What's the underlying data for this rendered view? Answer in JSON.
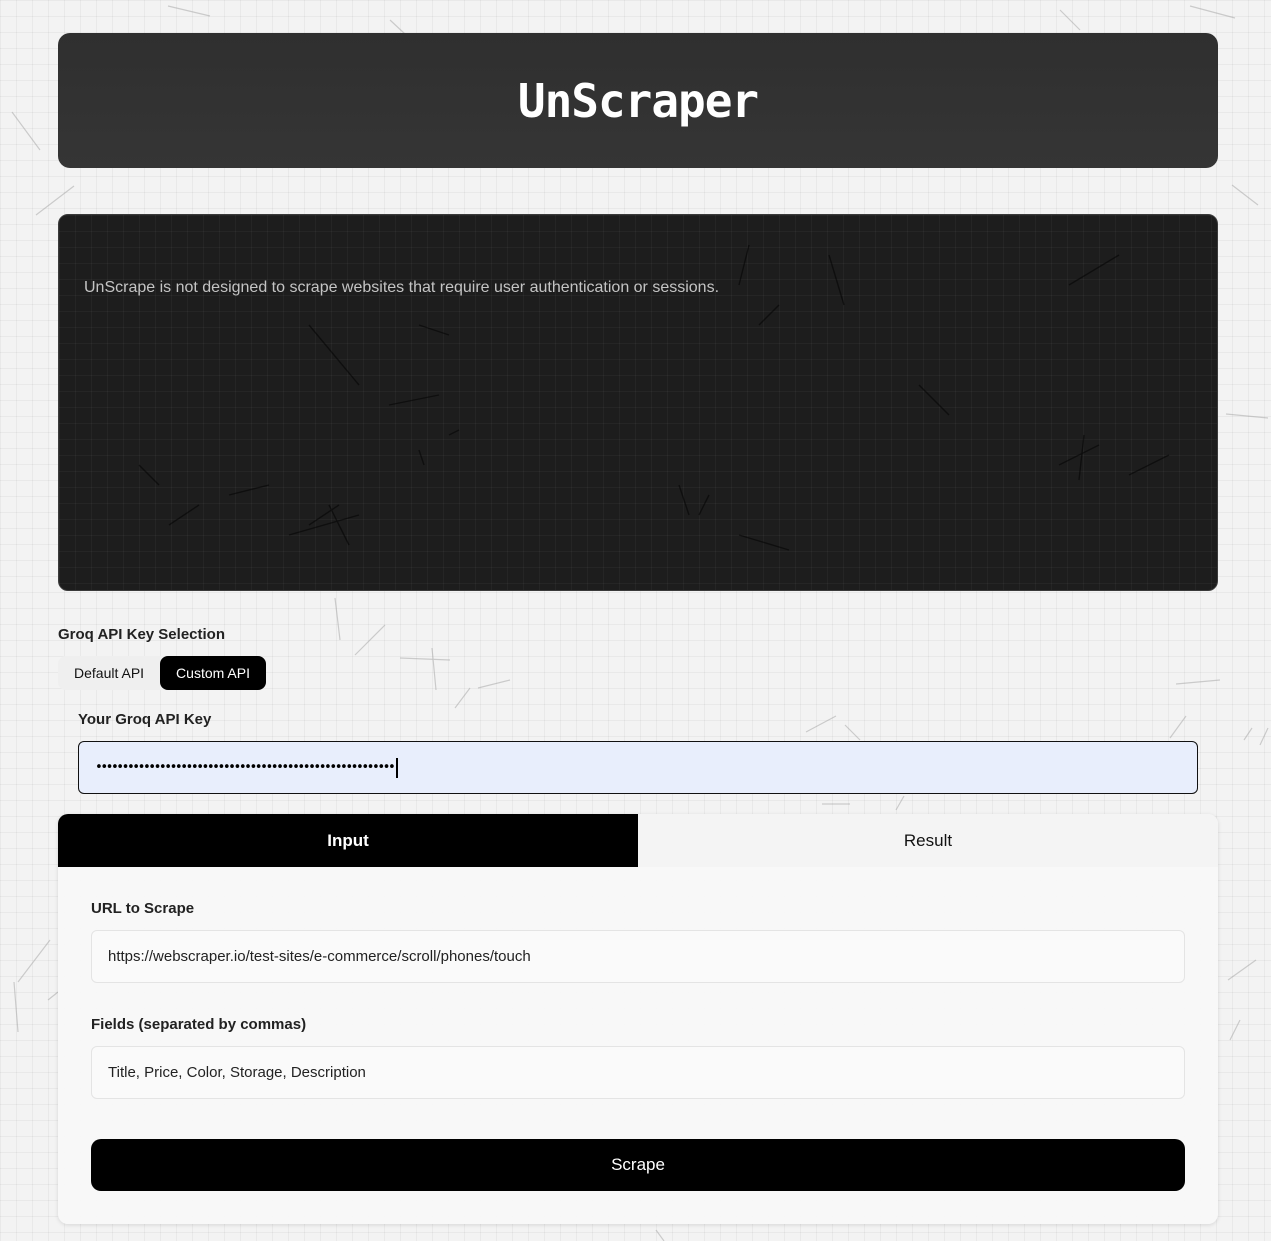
{
  "app": {
    "title": "UnScraper"
  },
  "notice": {
    "text": "UnScrape is not designed to scrape websites that require user authentication or sessions."
  },
  "api_selection": {
    "label": "Groq API Key Selection",
    "options": [
      "Default API",
      "Custom API"
    ],
    "selected": "Custom API"
  },
  "api_key": {
    "label": "Your Groq API Key",
    "masked_value": "••••••••••••••••••••••••••••••••••••••••••••••••••••••••"
  },
  "tabs": [
    {
      "label": "Input",
      "active": true
    },
    {
      "label": "Result",
      "active": false
    }
  ],
  "form": {
    "url_label": "URL to Scrape",
    "url_value": "https://webscraper.io/test-sites/e-commerce/scroll/phones/touch",
    "fields_label": "Fields (separated by commas)",
    "fields_value": "Title, Price, Color, Storage, Description",
    "submit_label": "Scrape"
  },
  "colors": {
    "background": "#f3f3f3",
    "header": "#333333",
    "panel": "#1d1d1d",
    "accent": "#000000",
    "key_input_bg": "#e8eefc"
  }
}
